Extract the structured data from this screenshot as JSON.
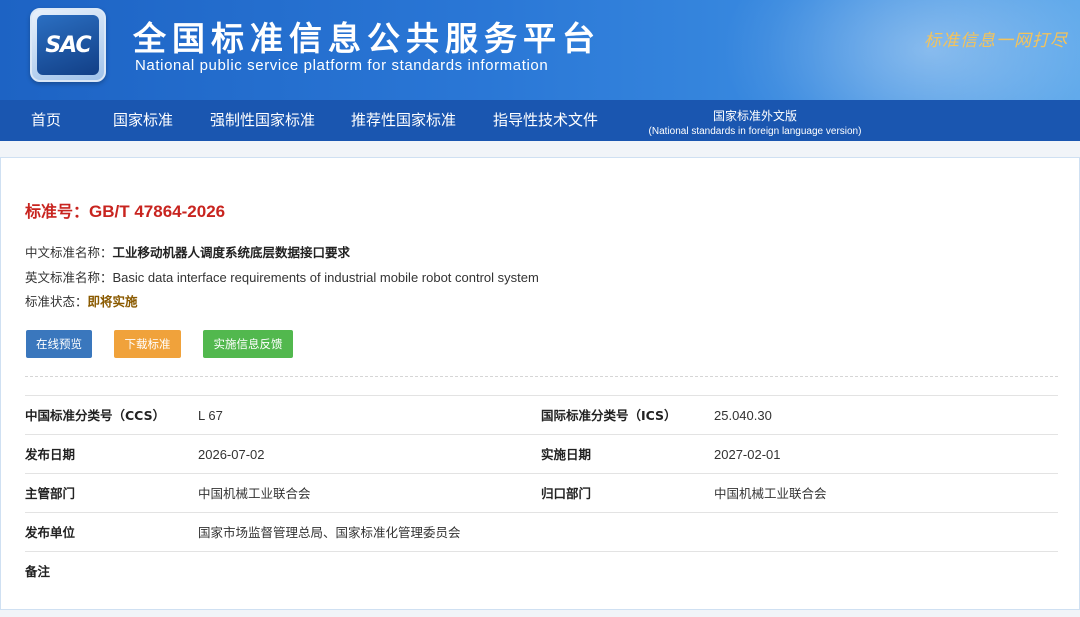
{
  "header": {
    "logo_text": "SAC",
    "title_cn": "全国标准信息公共服务平台",
    "title_en": "National public service platform  for standards information",
    "slogan": "标准信息一网打尽"
  },
  "nav": {
    "items": [
      {
        "label": "首页"
      },
      {
        "label": "国家标准"
      },
      {
        "label": "强制性国家标准"
      },
      {
        "label": "推荐性国家标准"
      },
      {
        "label": "指导性技术文件"
      }
    ],
    "foreign": {
      "label_cn": "国家标准外文版",
      "label_en": "(National standards in foreign language version)"
    }
  },
  "standard": {
    "number_label": "标准号：",
    "number": "GB/T 47864-2026",
    "cn_name_label": "中文标准名称：",
    "cn_name": "工业移动机器人调度系统底层数据接口要求",
    "en_name_label": "英文标准名称：",
    "en_name": "Basic data interface requirements of industrial mobile robot control system",
    "status_label": "标准状态：",
    "status": "即将实施"
  },
  "buttons": {
    "preview": "在线预览",
    "download": "下载标准",
    "feedback": "实施信息反馈"
  },
  "details": {
    "ccs_label": "中国标准分类号（CCS）",
    "ccs": "L 67",
    "ics_label": "国际标准分类号（ICS）",
    "ics": "25.040.30",
    "publish_date_label": "发布日期",
    "publish_date": "2026-07-02",
    "implement_date_label": "实施日期",
    "implement_date": "2027-02-01",
    "competent_label": "主管部门",
    "competent": "中国机械工业联合会",
    "centralized_label": "归口部门",
    "centralized": "中国机械工业联合会",
    "issuer_label": "发布单位",
    "issuer": "国家市场监督管理总局、国家标准化管理委员会",
    "remark_label": "备注",
    "remark": ""
  },
  "colors": {
    "banner": "#2a77d6",
    "nav": "#1a56b0",
    "standard_number": "#c8241f",
    "btn_preview": "#3a77bd",
    "btn_download": "#f0a23b",
    "btn_feedback": "#52b84e"
  }
}
